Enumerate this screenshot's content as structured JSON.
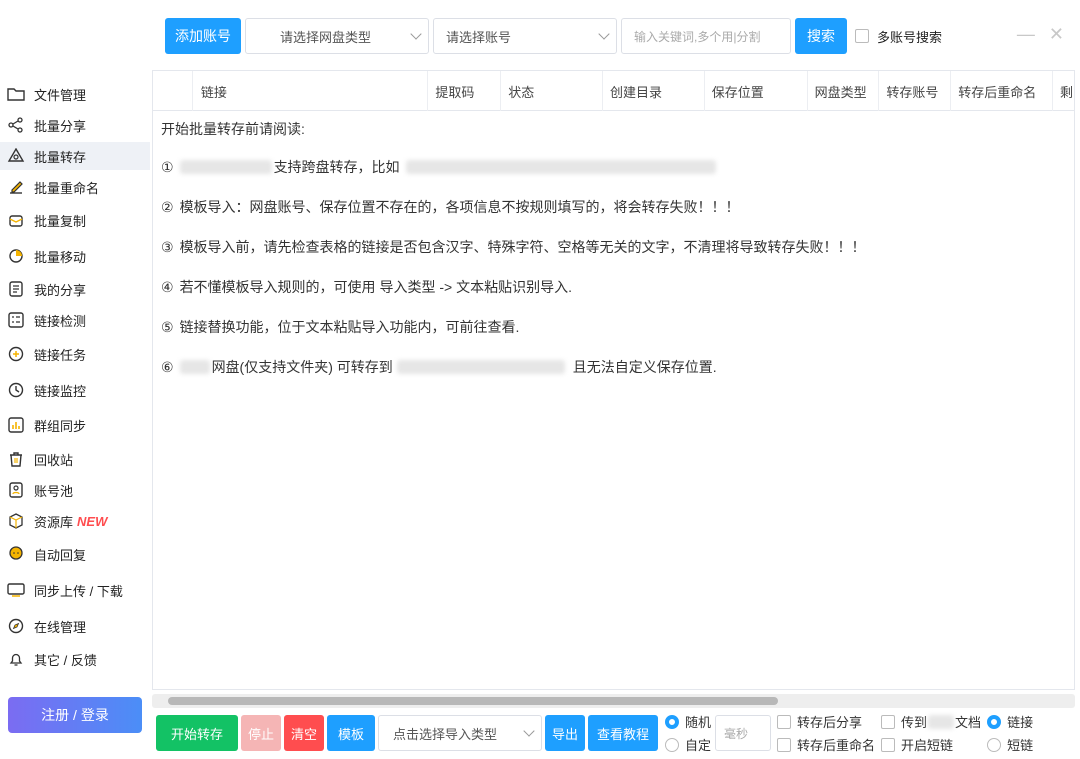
{
  "toolbar": {
    "add_account": "添加账号",
    "disk_type_placeholder": "请选择网盘类型",
    "account_placeholder": "请选择账号",
    "keyword_placeholder": "输入关键词,多个用|分割",
    "search": "搜索",
    "multi_account_search": "多账号搜索"
  },
  "sidebar": {
    "items": [
      {
        "label": "文件管理"
      },
      {
        "label": "批量分享"
      },
      {
        "label": "批量转存"
      },
      {
        "label": "批量重命名"
      },
      {
        "label": "批量复制"
      },
      {
        "label": "批量移动"
      },
      {
        "label": "我的分享"
      },
      {
        "label": "链接检测"
      },
      {
        "label": "链接任务"
      },
      {
        "label": "链接监控"
      },
      {
        "label": "群组同步"
      },
      {
        "label": "回收站"
      },
      {
        "label": "账号池"
      },
      {
        "label": "资源库",
        "badge": "NEW"
      },
      {
        "label": "自动回复"
      },
      {
        "label": "同步上传 / 下载"
      },
      {
        "label": "在线管理"
      },
      {
        "label": "其它 / 反馈"
      }
    ],
    "login": "注册 / 登录"
  },
  "table": {
    "columns": [
      "链接",
      "提取码",
      "状态",
      "创建目录",
      "保存位置",
      "网盘类型",
      "转存账号",
      "转存后重命名",
      "剩"
    ]
  },
  "notice": {
    "title": "开始批量转存前请阅读:",
    "lines": [
      {
        "num": "①",
        "text": "支持跨盘转存，比如"
      },
      {
        "num": "②",
        "text": "模板导入：网盘账号、保存位置不存在的，各项信息不按规则填写的，将会转存失败！！！"
      },
      {
        "num": "③",
        "text": "模板导入前，请先检查表格的链接是否包含汉字、特殊字符、空格等无关的文字，不清理将导致转存失败！！！"
      },
      {
        "num": "④",
        "text": "若不懂模板导入规则的，可使用 导入类型 -> 文本粘贴识别导入."
      },
      {
        "num": "⑤",
        "text": "链接替换功能，位于文本粘贴导入功能内，可前往查看."
      },
      {
        "num": "⑥",
        "text_a": "网盘(仅支持文件夹) 可转存到",
        "text_b": "且无法自定义保存位置."
      }
    ]
  },
  "bottom": {
    "start": "开始转存",
    "stop": "停止",
    "clear": "清空",
    "template": "模板",
    "import_type_placeholder": "点击选择导入类型",
    "export": "导出",
    "tutorial": "查看教程",
    "random": "随机",
    "custom": "自定",
    "ms_placeholder": "毫秒",
    "share_after": "转存后分享",
    "rename_after": "转存后重命名",
    "send_to_prefix": "传到",
    "send_to_suffix": "文档",
    "open_short": "开启短链",
    "link": "链接",
    "short_link": "短链"
  },
  "colors": {
    "primary": "#1e9fff",
    "green": "#13c265",
    "red": "#ff4d4f",
    "stop_disabled": "#f5b5b5"
  }
}
